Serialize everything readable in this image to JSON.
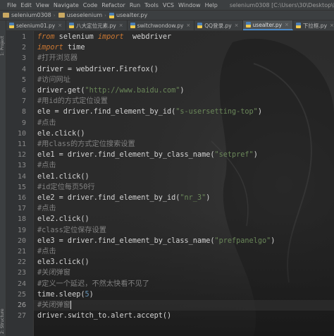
{
  "menubar": {
    "items": [
      "File",
      "Edit",
      "View",
      "Navigate",
      "Code",
      "Refactor",
      "Run",
      "Tools",
      "VCS",
      "Window",
      "Help"
    ],
    "window_title": "selenium0308 [C:\\Users\\30\\Desktop\\Python\\selenium0308]"
  },
  "breadcrumb": {
    "project": "selenium0308",
    "file": "useselenium",
    "module": "usealter.py"
  },
  "toolstrip": {
    "project_label": "1: Project",
    "structure_label": "2: Structure"
  },
  "tabs": [
    {
      "label": "selenium01.py",
      "active": false
    },
    {
      "label": "八大定位元素.py",
      "active": false
    },
    {
      "label": "switchwondow.py",
      "active": false
    },
    {
      "label": "QQ登录.py",
      "active": false
    },
    {
      "label": "usealter.py",
      "active": true
    },
    {
      "label": "下拉框.py",
      "active": false
    }
  ],
  "editor": {
    "current_line": 26,
    "lines": [
      {
        "no": "1",
        "text": "from selenium import  webdriver"
      },
      {
        "no": "2",
        "text": "import time"
      },
      {
        "no": "3",
        "text": "#打开浏览器"
      },
      {
        "no": "4",
        "text": "driver = webdriver.Firefox()"
      },
      {
        "no": "5",
        "text": "#访问网址"
      },
      {
        "no": "6",
        "text": "driver.get(\"http://www.baidu.com\")"
      },
      {
        "no": "7",
        "text": "#用id的方式定位设置"
      },
      {
        "no": "8",
        "text": "ele = driver.find_element_by_id(\"s-usersetting-top\")"
      },
      {
        "no": "9",
        "text": "#点击"
      },
      {
        "no": "10",
        "text": "ele.click()"
      },
      {
        "no": "11",
        "text": "#用class的方式定位搜索设置"
      },
      {
        "no": "12",
        "text": "ele1 = driver.find_element_by_class_name(\"setpref\")"
      },
      {
        "no": "13",
        "text": "#点击"
      },
      {
        "no": "14",
        "text": "ele1.click()"
      },
      {
        "no": "15",
        "text": "#id定位每页50行"
      },
      {
        "no": "16",
        "text": "ele2 = driver.find_element_by_id(\"nr_3\")"
      },
      {
        "no": "17",
        "text": "#点击"
      },
      {
        "no": "18",
        "text": "ele2.click()"
      },
      {
        "no": "19",
        "text": "#class定位保存设置"
      },
      {
        "no": "20",
        "text": "ele3 = driver.find_element_by_class_name(\"prefpanelgo\")"
      },
      {
        "no": "21",
        "text": "#点击"
      },
      {
        "no": "22",
        "text": "ele3.click()"
      },
      {
        "no": "23",
        "text": "#关闭弹窗"
      },
      {
        "no": "24",
        "text": "#定义一个延迟，不然太快看不见了"
      },
      {
        "no": "25",
        "text": "time.sleep(5)"
      },
      {
        "no": "26",
        "text": "#关闭弹窗"
      },
      {
        "no": "27",
        "text": "driver.switch_to.alert.accept()"
      }
    ]
  },
  "colors": {
    "keyword": "#cc7832",
    "string": "#6a8759",
    "number": "#6897bb",
    "comment": "#808080",
    "editor_bg": "#2b2b2b"
  }
}
